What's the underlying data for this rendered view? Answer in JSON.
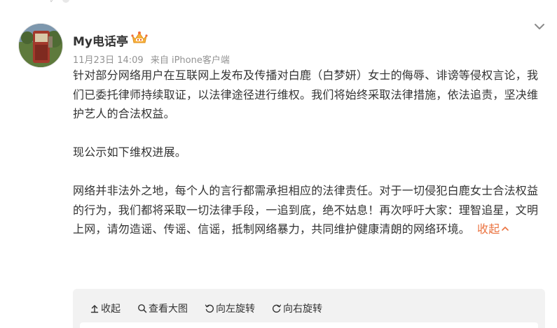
{
  "post": {
    "author": {
      "name": "My电话亭",
      "badge_icon": "vip-crown-icon"
    },
    "meta": {
      "date": "11月23日 14:09",
      "source": "来自 iPhone客户端"
    },
    "paragraphs": [
      "针对部分网络用户在互联网上发布及传播对白鹿（白梦妍）女士的侮辱、诽谤等侵权言论，我们已委托律师持续取证，以法律途径进行维权。我们将始终采取法律措施，依法追责，坚决维护艺人的合法权益。",
      "现公示如下维权进展。",
      "网络并非法外之地，每个人的言行都需承担相应的法律责任。对于一切侵犯白鹿女士合法权益的行为，我们都将采取一切法律手段，一追到底，绝不姑息！再次呼吁大家：理智追星，文明上网，请勿造谣、传谣、信谣，抵制网络暴力，共同维护健康清朗的网络环境。"
    ],
    "collapse_label": "收起"
  },
  "toolbar": {
    "collapse_label": "收起",
    "view_large_label": "查看大图",
    "rotate_left_label": "向左旋转",
    "rotate_right_label": "向右旋转"
  },
  "colors": {
    "link": "#eb7340",
    "meta_text": "#939393",
    "body_text": "#333333",
    "media_bg": "#f2f2f2"
  }
}
